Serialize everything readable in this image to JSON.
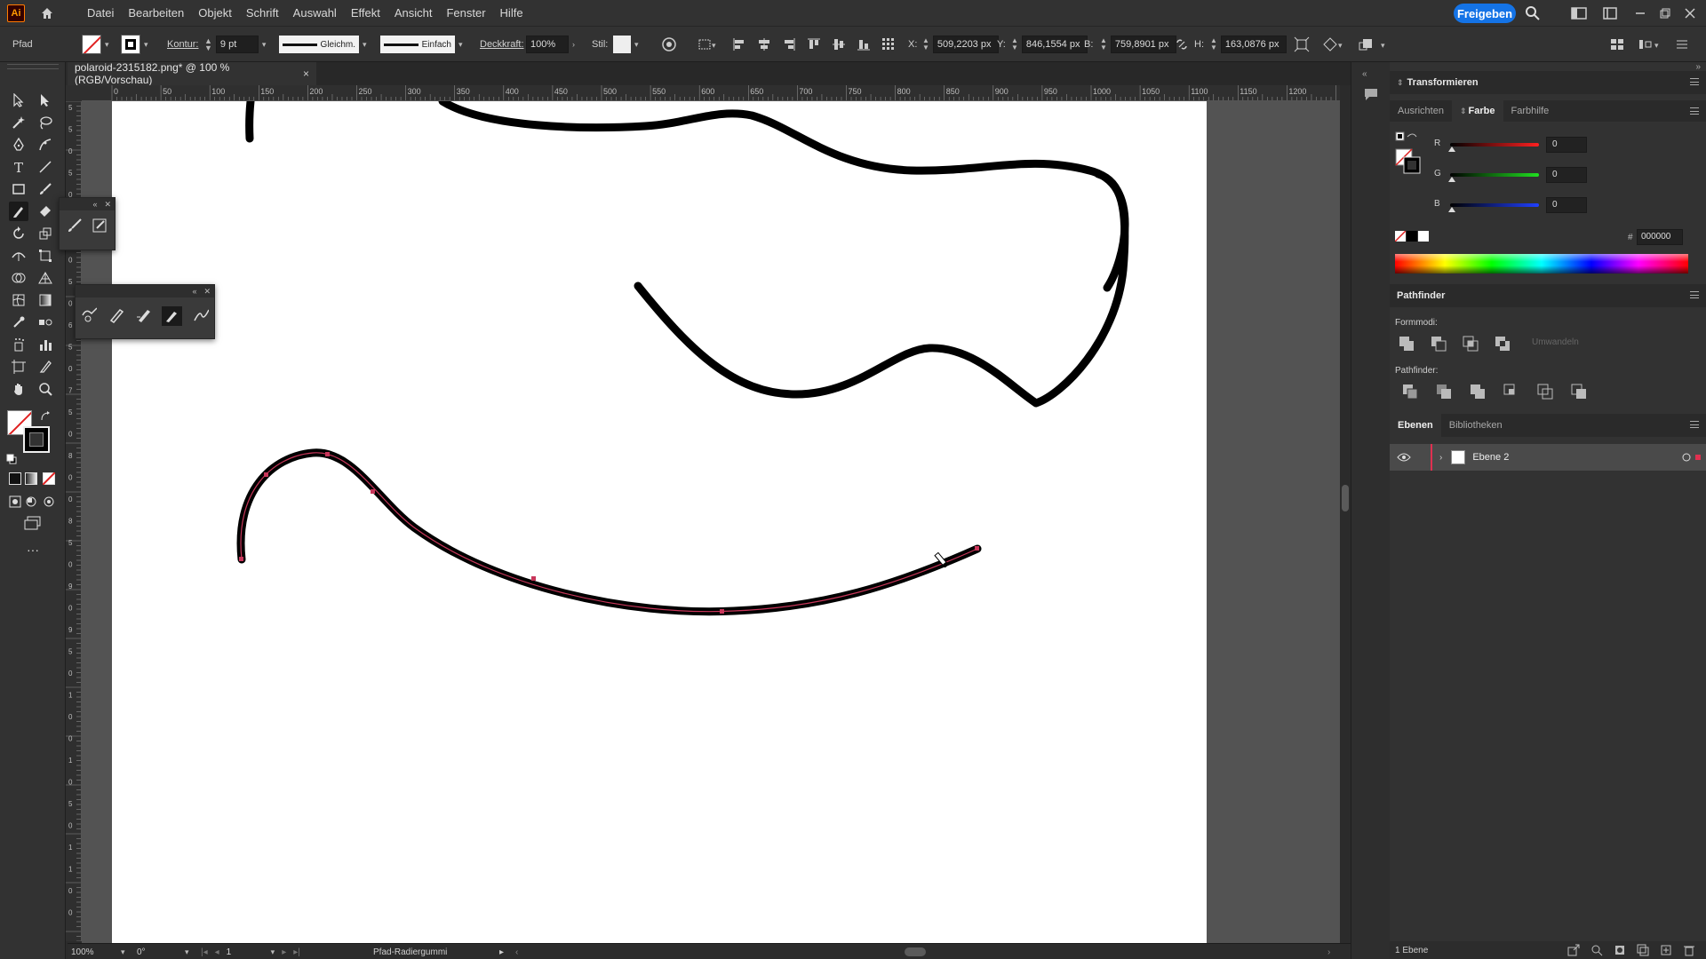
{
  "app": {
    "logo_text": "Ai",
    "share_button": "Freigeben"
  },
  "menu": [
    "Datei",
    "Bearbeiten",
    "Objekt",
    "Schrift",
    "Auswahl",
    "Effekt",
    "Ansicht",
    "Fenster",
    "Hilfe"
  ],
  "control": {
    "selection_type": "Pfad",
    "stroke_label": "Kontur:",
    "stroke_weight": "9 pt",
    "stroke_profile": "Gleichm.",
    "brush": "Einfach",
    "opacity_label": "Deckkraft:",
    "opacity_value": "100%",
    "style_label": "Stil:",
    "x_label": "X:",
    "x_value": "509,2203 px",
    "y_label": "Y:",
    "y_value": "846,1554 px",
    "w_label": "B:",
    "w_value": "759,8901 px",
    "h_label": "H:",
    "h_value": "163,0876 px"
  },
  "document": {
    "tab_title": "polaroid-2315182.png* @ 100 % (RGB/Vorschau)",
    "close": "×"
  },
  "ruler_top_labels": [
    "0",
    "50",
    "100",
    "150",
    "200",
    "250",
    "300",
    "350",
    "400",
    "450",
    "500",
    "550",
    "600",
    "650",
    "700",
    "750",
    "800",
    "850",
    "900",
    "950",
    "1000",
    "1050",
    "1100",
    "1150",
    "1200",
    "12"
  ],
  "ruler_left_labels": [
    "5",
    "5",
    "0",
    "5",
    "0",
    "0",
    "5",
    "0",
    "5",
    "0",
    "6",
    "5",
    "0",
    "7",
    "5",
    "0",
    "8",
    "0",
    "0",
    "8",
    "5",
    "0",
    "9",
    "0",
    "9",
    "5",
    "0",
    "1",
    "0",
    "0",
    "1",
    "0",
    "5",
    "0",
    "1",
    "1",
    "0",
    "0"
  ],
  "status": {
    "zoom": "100%",
    "rotation": "0°",
    "artboard": "1",
    "tool_name": "Pfad-Radiergummi"
  },
  "panels": {
    "transform": "Transformieren",
    "color_tabs": [
      "Ausrichten",
      "Farbe",
      "Farbhilfe"
    ],
    "active_color_tab": "Farbe",
    "rgb": [
      {
        "label": "R",
        "value": "0",
        "color": "#e03030"
      },
      {
        "label": "G",
        "value": "0",
        "color": "#30c030"
      },
      {
        "label": "B",
        "value": "0",
        "color": "#3040e0"
      }
    ],
    "hex_label": "#",
    "hex_value": "000000",
    "pathfinder": "Pathfinder",
    "shape_modes": "Formmodi:",
    "expand": "Umwandeln",
    "pathfinder_label": "Pathfinder:",
    "layers_tabs": [
      "Ebenen",
      "Bibliotheken"
    ],
    "layer_name": "Ebene 2",
    "layer_count": "1 Ebene"
  },
  "colors": {
    "accent": "#1473e6",
    "selection": "#c8365a",
    "panel_bg": "#323232"
  }
}
